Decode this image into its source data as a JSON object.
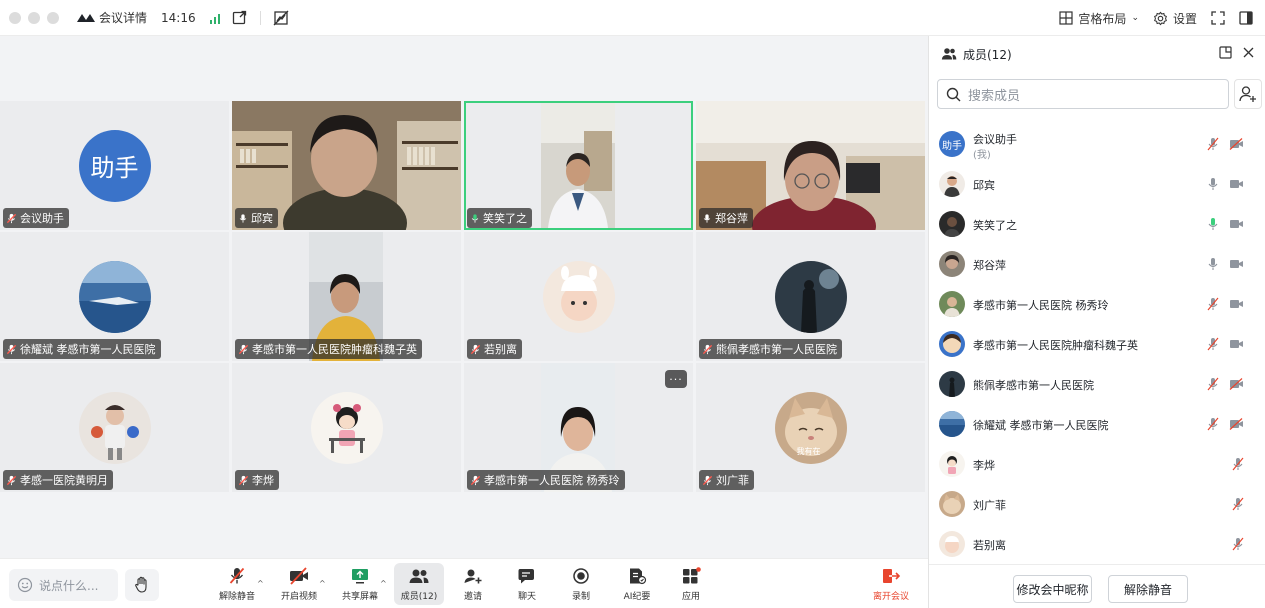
{
  "titlebar": {
    "app_title": "会议详情",
    "time": "14:16",
    "layout_label": "宫格布局",
    "settings_label": "设置"
  },
  "tiles": [
    {
      "name": "会议助手",
      "avatar_text": "助手"
    },
    {
      "name": "邱宾"
    },
    {
      "name": "笑笑了之"
    },
    {
      "name": "郑谷萍"
    },
    {
      "name": "徐耀斌  孝感市第一人民医院"
    },
    {
      "name": "孝感市第一人民医院肿瘤科魏子英"
    },
    {
      "name": "若别离"
    },
    {
      "name": "熊佩孝感市第一人民医院"
    },
    {
      "name": "孝感一医院黄明月"
    },
    {
      "name": "李烨"
    },
    {
      "name": "孝感市第一人民医院 杨秀玲",
      "more": "···"
    },
    {
      "name": "刘广菲",
      "overlay_text": "我有在"
    }
  ],
  "toolbar": {
    "say_placeholder": "说点什么...",
    "unmute": "解除静音",
    "video": "开启视频",
    "share": "共享屏幕",
    "members": "成员(12)",
    "invite": "邀请",
    "chat": "聊天",
    "record": "录制",
    "ai_notes": "AI纪要",
    "apps": "应用",
    "leave": "离开会议"
  },
  "panel": {
    "title": "成员(12)",
    "search_placeholder": "搜索成员",
    "members": [
      {
        "name": "会议助手",
        "sub": "(我)",
        "avatar_text": "助手",
        "mic": "muted",
        "cam": "off"
      },
      {
        "name": "邱宾",
        "mic": "on",
        "cam": "on"
      },
      {
        "name": "笑笑了之",
        "mic": "speaking",
        "cam": "on"
      },
      {
        "name": "郑谷萍",
        "mic": "on",
        "cam": "on"
      },
      {
        "name": "孝感市第一人民医院 杨秀玲",
        "mic": "muted",
        "cam": "on"
      },
      {
        "name": "孝感市第一人民医院肿瘤科魏子英",
        "mic": "muted",
        "cam": "on"
      },
      {
        "name": "熊佩孝感市第一人民医院",
        "mic": "muted",
        "cam": "off"
      },
      {
        "name": "徐耀斌  孝感市第一人民医院",
        "mic": "muted",
        "cam": "off"
      },
      {
        "name": "李烨",
        "mic": "muted",
        "cam": "none"
      },
      {
        "name": "刘广菲",
        "mic": "muted",
        "cam": "none"
      },
      {
        "name": "若别离",
        "mic": "muted",
        "cam": "none"
      }
    ],
    "rename_button": "修改会中昵称",
    "unmute_button": "解除静音"
  },
  "colors": {
    "accent_green": "#3ccf7d",
    "assistant_blue": "#3a73c9",
    "leave_red": "#e8452e",
    "stage_bg": "#f2f3f5"
  }
}
